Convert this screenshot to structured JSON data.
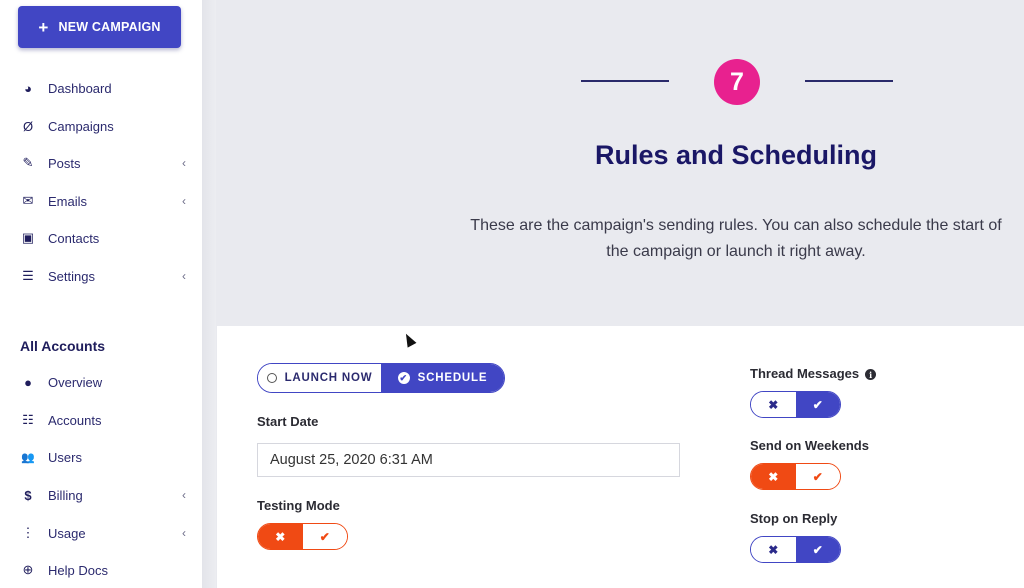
{
  "sidebar": {
    "new_campaign_label": "NEW CAMPAIGN",
    "main_items": [
      {
        "label": "Dashboard",
        "icon": "dashboard-icon",
        "glyph": "◕",
        "has_submenu": false
      },
      {
        "label": "Campaigns",
        "icon": "campaigns-icon",
        "glyph": "Ø",
        "has_submenu": false
      },
      {
        "label": "Posts",
        "icon": "pencil-icon",
        "glyph": "✎",
        "has_submenu": true
      },
      {
        "label": "Emails",
        "icon": "envelope-icon",
        "glyph": "✉",
        "has_submenu": true
      },
      {
        "label": "Contacts",
        "icon": "contact-card-icon",
        "glyph": "▣",
        "has_submenu": false
      },
      {
        "label": "Settings",
        "icon": "sliders-icon",
        "glyph": "☰",
        "has_submenu": true
      }
    ],
    "section_title": "All Accounts",
    "account_items": [
      {
        "label": "Overview",
        "icon": "globe-icon",
        "glyph": "●",
        "has_submenu": false
      },
      {
        "label": "Accounts",
        "icon": "server-icon",
        "glyph": "☷",
        "has_submenu": false
      },
      {
        "label": "Users",
        "icon": "users-icon",
        "glyph": "👥",
        "has_submenu": false
      },
      {
        "label": "Billing",
        "icon": "dollar-icon",
        "glyph": "$",
        "has_submenu": true
      },
      {
        "label": "Usage",
        "icon": "usage-icon",
        "glyph": "⋮",
        "has_submenu": true
      },
      {
        "label": "Help Docs",
        "icon": "lifebuoy-icon",
        "glyph": "⊕",
        "has_submenu": false
      }
    ],
    "chevron_glyph": "‹"
  },
  "header": {
    "step_number": "7",
    "title": "Rules and Scheduling",
    "description": "These are the campaign's sending rules. You can also schedule the start of the campaign or launch it right away."
  },
  "form": {
    "launch_mode": {
      "options": [
        "LAUNCH NOW",
        "SCHEDULE"
      ],
      "selected": "SCHEDULE"
    },
    "start_date_label": "Start Date",
    "start_date_value": "August 25, 2020 6:31 AM",
    "testing_mode": {
      "label": "Testing Mode",
      "value": false
    },
    "thread_messages": {
      "label": "Thread Messages",
      "value": true
    },
    "send_on_weekends": {
      "label": "Send on Weekends",
      "value": false
    },
    "stop_on_reply": {
      "label": "Stop on Reply",
      "value": true
    },
    "x_glyph": "✖",
    "check_glyph": "✔"
  },
  "colors": {
    "primary": "#4146c4",
    "danger": "#f04a14",
    "step_badge": "#e8218f",
    "title": "#1a1766"
  }
}
